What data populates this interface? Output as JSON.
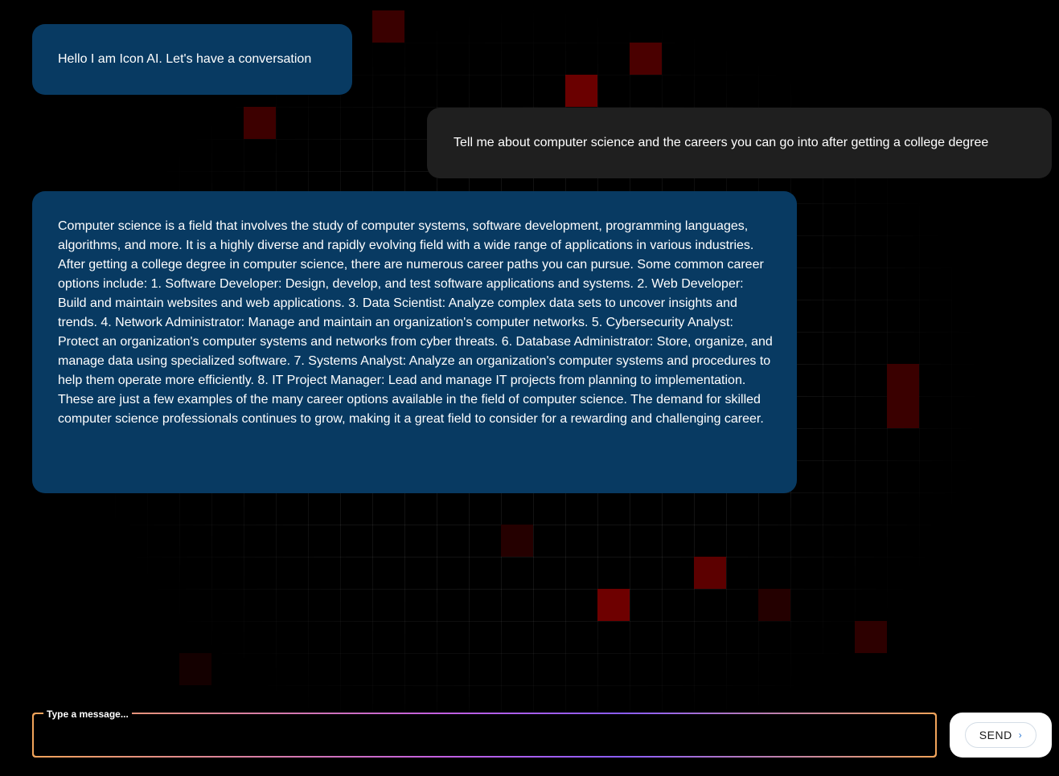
{
  "colors": {
    "background": "#000000",
    "ai_bubble": "#083a62",
    "user_bubble": "#1f1f1f",
    "grid_highlight": "#6e0000",
    "input_border_gradient": [
      "#f2a45a",
      "#c35fe0",
      "#8a5cff"
    ]
  },
  "messages": [
    {
      "role": "ai",
      "text": "Hello I am Icon AI. Let's have a conversation"
    },
    {
      "role": "user",
      "text": "Tell me about computer science and the careers you can go into after getting a college degree"
    },
    {
      "role": "ai",
      "text": "Computer science is a field that involves the study of computer systems, software development, programming languages, algorithms, and more. It is a highly diverse and rapidly evolving field with a wide range of applications in various industries. After getting a college degree in computer science, there are numerous career paths you can pursue. Some common career options include: 1. Software Developer: Design, develop, and test software applications and systems. 2. Web Developer: Build and maintain websites and web applications. 3. Data Scientist: Analyze complex data sets to uncover insights and trends. 4. Network Administrator: Manage and maintain an organization's computer networks. 5. Cybersecurity Analyst: Protect an organization's computer systems and networks from cyber threats. 6. Database Administrator: Store, organize, and manage data using specialized software. 7. Systems Analyst: Analyze an organization's computer systems and procedures to help them operate more efficiently. 8. IT Project Manager: Lead and manage IT projects from planning to implementation. These are just a few examples of the many career options available in the field of computer science. The demand for skilled computer science professionals continues to grow, making it a great field to consider for a rewarding and challenging career."
    }
  ],
  "composer": {
    "label": "Type a message...",
    "value": "",
    "send_label": "SEND",
    "send_icon": "chevron-right-icon"
  }
}
